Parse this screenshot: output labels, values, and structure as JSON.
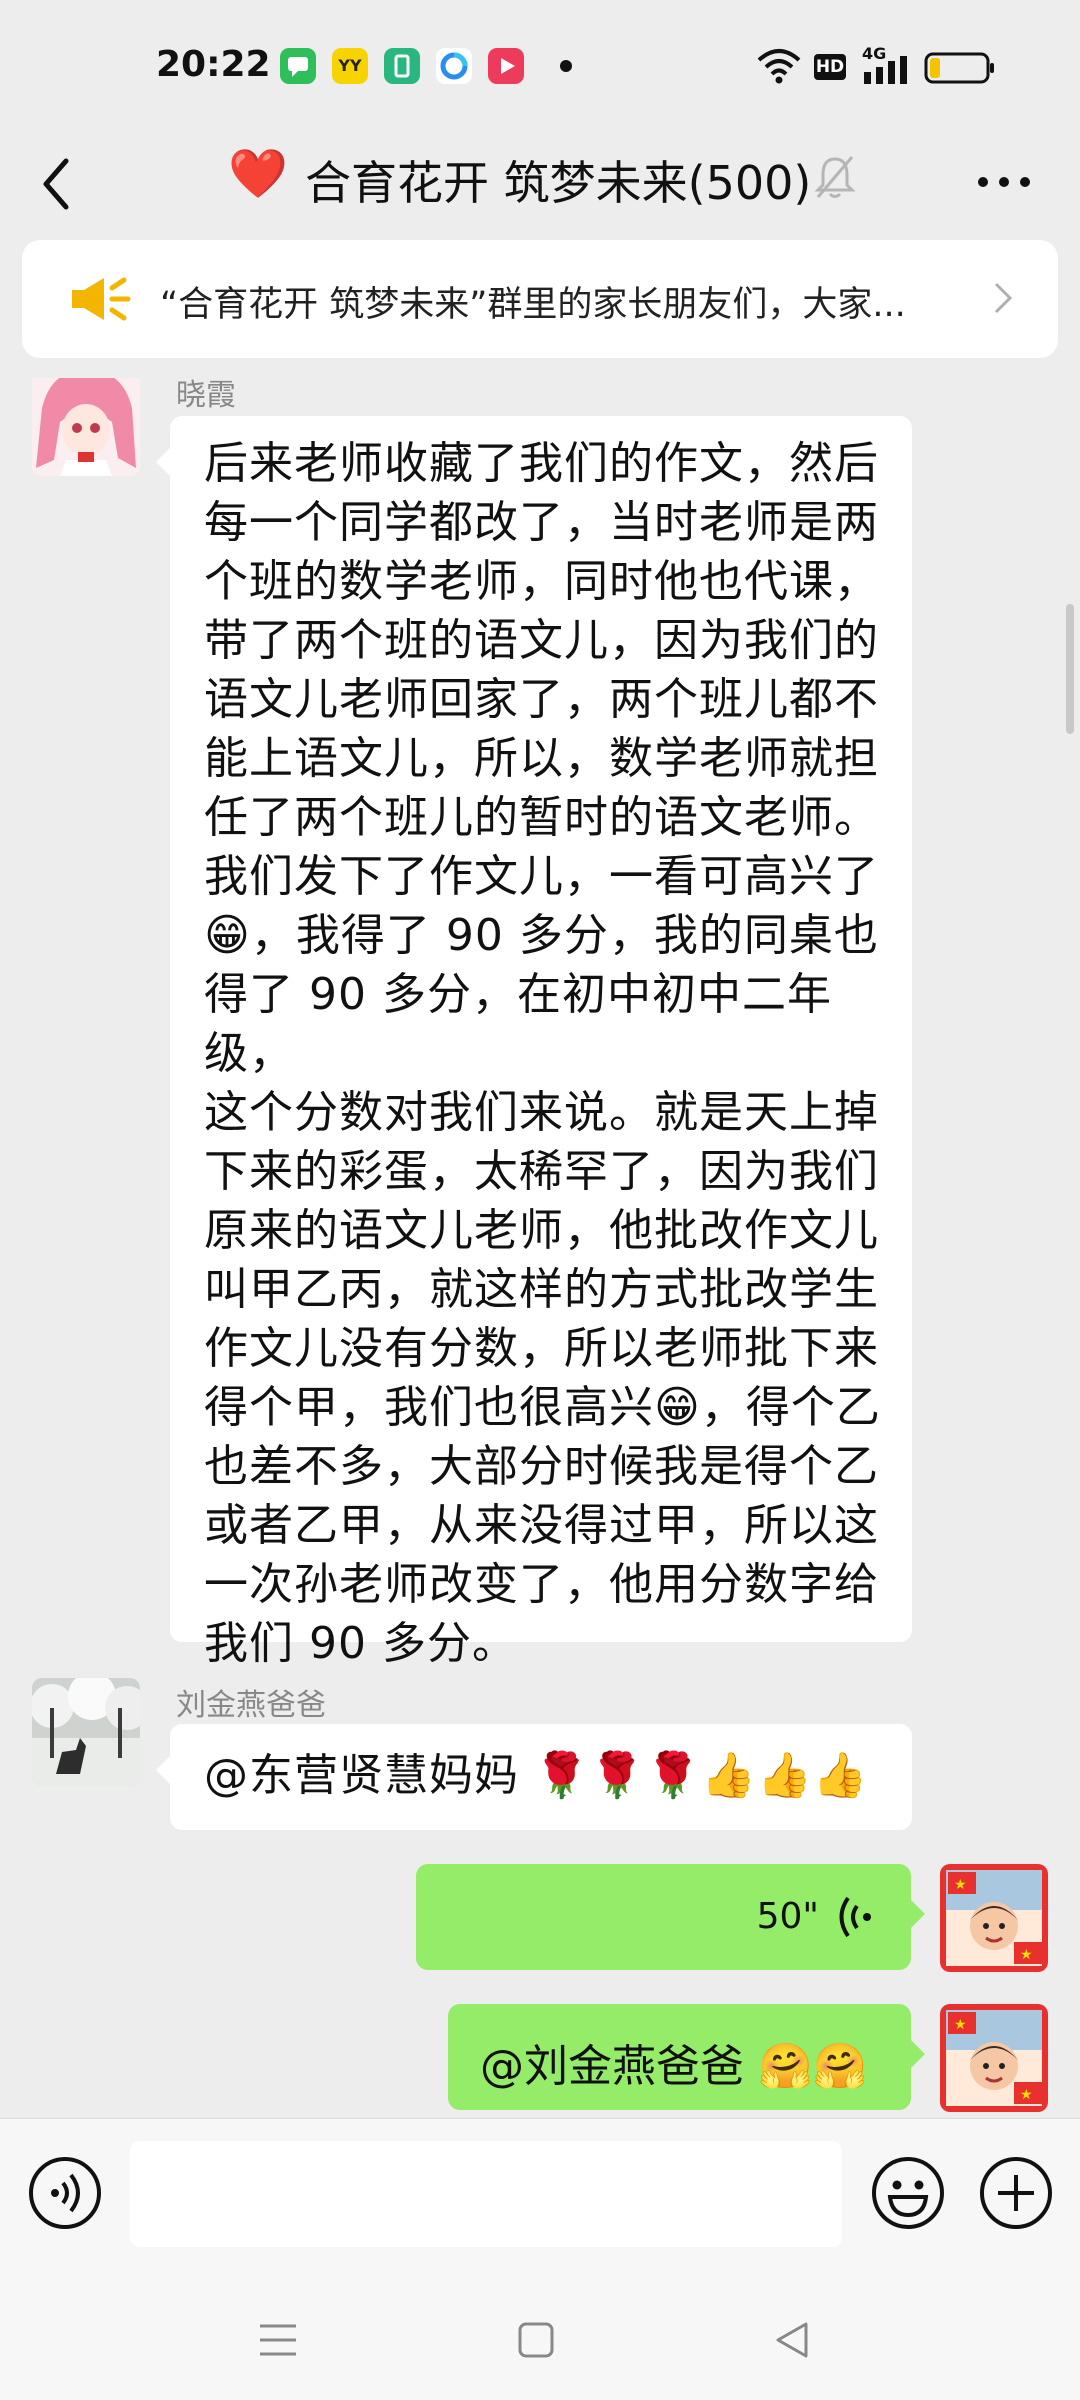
{
  "status_bar": {
    "time": "20:22",
    "app_icons": [
      {
        "name": "messages-app-icon",
        "color": "#2fbf5a"
      },
      {
        "name": "yy-app-icon",
        "color": "#f7d400",
        "label": "YY"
      },
      {
        "name": "sim-app-icon",
        "color": "#29b67f"
      },
      {
        "name": "browser-app-icon",
        "color": "#ffffff"
      },
      {
        "name": "video-app-icon",
        "color": "#ee3b5b"
      }
    ],
    "hd_label": "HD",
    "network_label": "4G"
  },
  "header": {
    "title_emoji": "❤️",
    "title": "合育花开 筑梦未来(500)"
  },
  "announcement": {
    "text": "“合育花开 筑梦未来”群里的家长朋友们，大家..."
  },
  "messages": [
    {
      "sender": "晓霞",
      "type": "text",
      "lines": [
        "后来老师收藏了我们的作文，然后",
        "每一个同学都改了，当时老师是两",
        "个班的数学老师，同时他也代课，",
        "带了两个班的语文儿，因为我们的",
        "语文儿老师回家了，两个班儿都不",
        "能上语文儿，所以，数学老师就担",
        "任了两个班儿的暂时的语文老师。",
        "我们发下了作文儿，一看可高兴了",
        "😁，我得了 90 多分，我的同桌也",
        "得了 90 多分，在初中初中二年级，",
        "这个分数对我们来说。就是天上掉",
        "下来的彩蛋，太稀罕了，因为我们",
        "原来的语文儿老师，他批改作文儿",
        "叫甲乙丙，就这样的方式批改学生",
        "作文儿没有分数，所以老师批下来",
        "得个甲，我们也很高兴😁，得个乙",
        "也差不多，大部分时候我是得个乙",
        "或者乙甲，从来没得过甲，所以这",
        "一次孙老师改变了，他用分数字给",
        "我们 90 多分。"
      ]
    },
    {
      "sender": "刘金燕爸爸",
      "type": "text",
      "text": "@东营贤慧妈妈 🌹🌹🌹👍👍👍"
    },
    {
      "sender": "me",
      "type": "voice",
      "duration": "50\""
    },
    {
      "sender": "me",
      "type": "text",
      "text": "@刘金燕爸爸 🤗🤗"
    }
  ],
  "colors": {
    "outgoing_bubble": "#95ec69",
    "incoming_bubble": "#ffffff",
    "background": "#ededed"
  }
}
